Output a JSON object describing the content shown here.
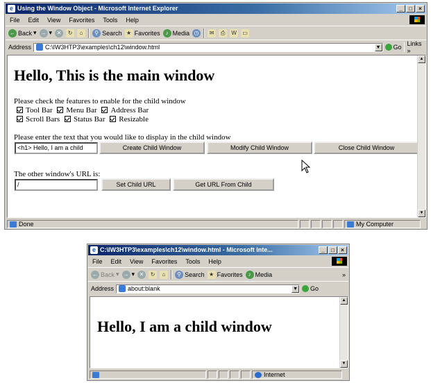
{
  "main_window": {
    "title": "Using the Window Object - Microsoft Internet Explorer",
    "menu": [
      "File",
      "Edit",
      "View",
      "Favorites",
      "Tools",
      "Help"
    ],
    "toolbar": {
      "back": "Back",
      "search": "Search",
      "favorites": "Favorites",
      "media": "Media"
    },
    "address_label": "Address",
    "address_value": "C:\\IW3HTP3\\examples\\ch12\\window.html",
    "go_label": "Go",
    "links_label": "Links »",
    "page": {
      "heading": "Hello, This is the main window",
      "features_prompt": "Please check the features to enable for the child window",
      "checkboxes_row1": [
        "Tool Bar",
        "Menu Bar",
        "Address Bar"
      ],
      "checkboxes_row2": [
        "Scroll Bars",
        "Status Bar",
        "Resizable"
      ],
      "text_prompt": "Please enter the text that you would like to display in the child window",
      "text_value": "<h1> Hello, I am a child",
      "btn_create": "Create Child Window",
      "btn_modify": "Modify Child Window",
      "btn_close": "Close Child Window",
      "url_prompt": "The other window's URL is:",
      "url_value": "/",
      "btn_set_url": "Set Child URL",
      "btn_get_url": "Get URL From Child"
    },
    "status_text": "Done",
    "status_zone": "My Computer"
  },
  "child_window": {
    "title": "C:\\IW3HTP3\\examples\\ch12\\window.html - Microsoft Inte...",
    "menu": [
      "File",
      "Edit",
      "View",
      "Favorites",
      "Tools",
      "Help"
    ],
    "toolbar": {
      "back": "Back",
      "search": "Search",
      "favorites": "Favorites",
      "media": "Media"
    },
    "address_label": "Address",
    "address_value": "about:blank",
    "go_label": "Go",
    "heading": "Hello, I am a child window",
    "status_zone": "Internet"
  }
}
